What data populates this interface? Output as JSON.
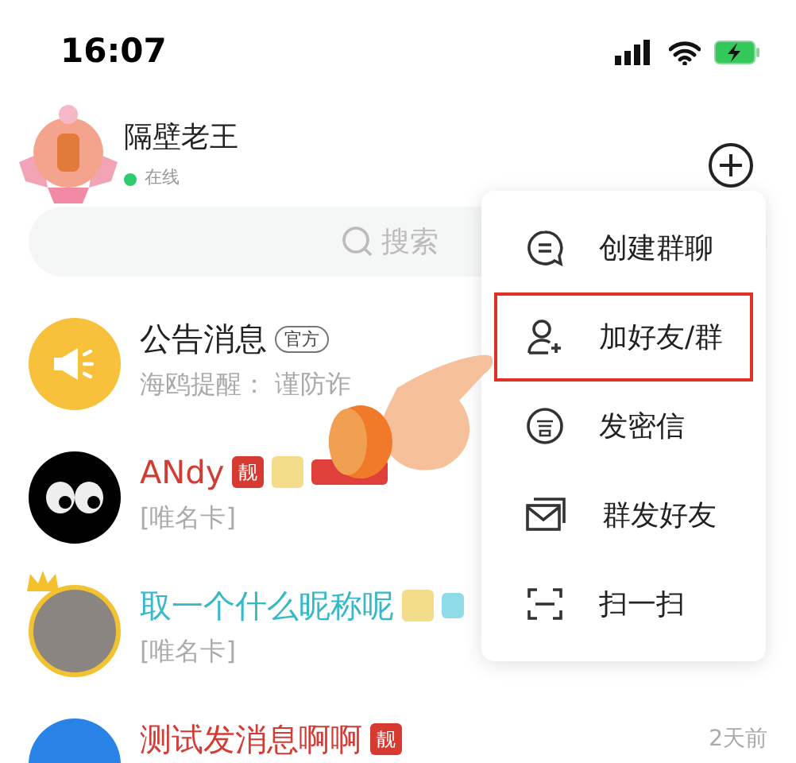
{
  "status_bar": {
    "time": "16:07"
  },
  "profile": {
    "name": "隔壁老王",
    "status": "在线",
    "online": true
  },
  "search": {
    "placeholder": "搜索"
  },
  "chats": [
    {
      "kind": "megaphone",
      "name": "公告消息",
      "color": "#222222",
      "badges": [
        {
          "kind": "official",
          "text": "官方"
        }
      ],
      "preview": "海鸥提醒： 谨防诈"
    },
    {
      "kind": "eyes",
      "name": "ANdy",
      "color": "#d33b35",
      "badges": [
        {
          "kind": "liang",
          "text": "靓"
        },
        {
          "kind": "vip"
        },
        {
          "kind": "gem"
        }
      ],
      "preview": "[唯名卡]"
    },
    {
      "kind": "photo",
      "name": "取一个什么昵称呢",
      "color": "#35b8c8",
      "badges": [
        {
          "kind": "vip"
        },
        {
          "kind": "diamond"
        }
      ],
      "preview": "[唯名卡]"
    },
    {
      "kind": "blue",
      "name": "测试发消息啊啊",
      "color": "#d33b35",
      "badges": [
        {
          "kind": "liang",
          "text": "靓"
        }
      ],
      "time": "2天前"
    }
  ],
  "menu": [
    {
      "kind": "chat",
      "label": "创建群聊",
      "selected": false
    },
    {
      "kind": "add-user",
      "label": "加好友/群",
      "selected": true
    },
    {
      "kind": "secret",
      "label": "发密信",
      "selected": false
    },
    {
      "kind": "mail",
      "label": "群发好友",
      "selected": false
    },
    {
      "kind": "scan",
      "label": "扫一扫",
      "selected": false
    }
  ]
}
